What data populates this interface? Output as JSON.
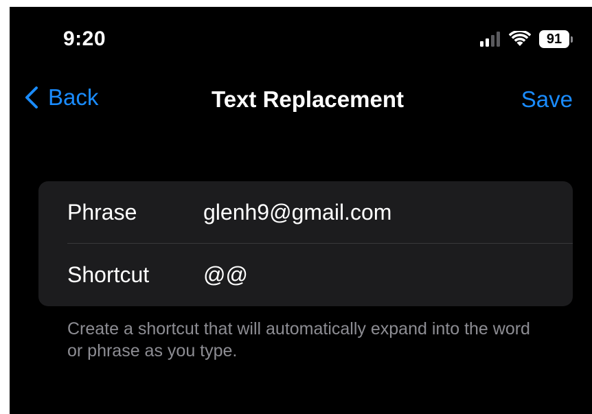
{
  "status_bar": {
    "time": "9:20",
    "battery_level": "91",
    "signal_icon": "cellular-signal-icon",
    "wifi_icon": "wifi-icon"
  },
  "nav": {
    "back_label": "Back",
    "back_icon": "chevron-left-icon",
    "title": "Text Replacement",
    "save_label": "Save"
  },
  "form": {
    "phrase_label": "Phrase",
    "phrase_value": "glenh9@gmail.com",
    "shortcut_label": "Shortcut",
    "shortcut_value": "@@"
  },
  "footer_note": "Create a shortcut that will automatically expand into the word or phrase as you type.",
  "colors": {
    "background": "#000000",
    "card": "#1c1c1e",
    "accent": "#1a8cff",
    "secondary_text": "#8d8d93"
  }
}
